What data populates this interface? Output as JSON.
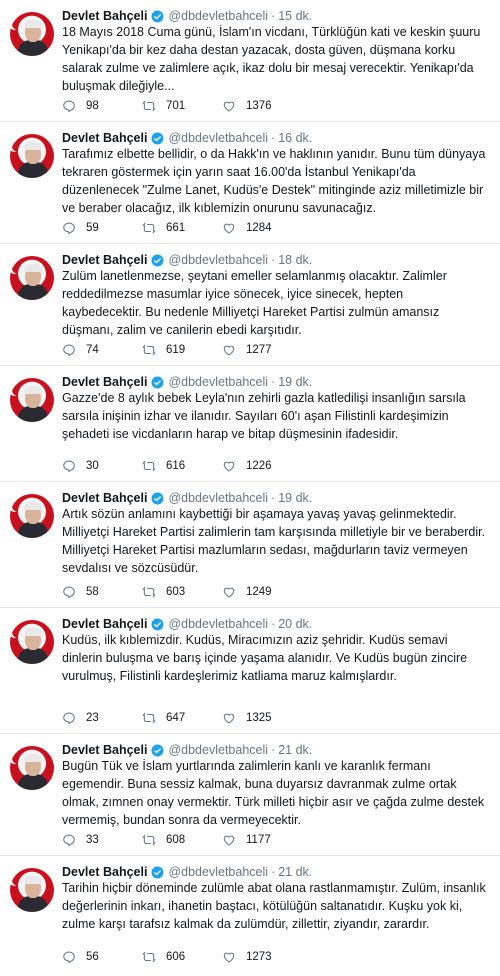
{
  "tweets": [
    {
      "name": "Devlet Bahçeli",
      "handle": "@dbdevletbahceli",
      "time": "15 dk.",
      "text": "18 Mayıs 2018 Cuma günü, İslam'ın vicdanı, Türklüğün kati ve keskin şuuru Yenikapı'da bir kez daha destan yazacak, dosta güven, düşmana korku salarak zulme ve zalimlere açık, ikaz dolu bir mesaj verecektir. Yenikapı'da buluşmak dileğiyle...",
      "replies": "98",
      "retweets": "701",
      "likes": "1376"
    },
    {
      "name": "Devlet Bahçeli",
      "handle": "@dbdevletbahceli",
      "time": "16 dk.",
      "text": "Tarafımız elbette bellidir, o da Hakk'ın ve haklının yanıdır. Bunu tüm dünyaya tekraren göstermek için yarın saat 16.00'da İstanbul Yenikapı'da düzenlenecek \"Zulme Lanet, Kudüs'e Destek\" mitinginde aziz milletimizle bir ve beraber olacağız, ilk kıblemizin onurunu savunacağız.",
      "replies": "59",
      "retweets": "661",
      "likes": "1284"
    },
    {
      "name": "Devlet Bahçeli",
      "handle": "@dbdevletbahceli",
      "time": "18 dk.",
      "text": "Zulüm lanetlenmezse, şeytani emeller selamlanmış olacaktır. Zalimler reddedilmezse masumlar iyice sönecek, iyice sinecek, hepten kaybedecektir. Bu nedenle Milliyetçi Hareket Partisi zulmün amansız düşmanı, zalim ve canilerin ebedi karşıtıdır.",
      "replies": "74",
      "retweets": "619",
      "likes": "1277"
    },
    {
      "name": "Devlet Bahçeli",
      "handle": "@dbdevletbahceli",
      "time": "19 dk.",
      "text": "Gazze'de 8 aylık bebek Leyla'nın zehirli gazla katledilişi insanlığın sarsıla sarsıla inişinin izhar ve ilanıdır. Sayıları 60'ı aşan Filistinli kardeşimizin şehadeti ise vicdanların harap ve bitap düşmesinin ifadesidir.",
      "replies": "30",
      "retweets": "616",
      "likes": "1226"
    },
    {
      "name": "Devlet Bahçeli",
      "handle": "@dbdevletbahceli",
      "time": "19 dk.",
      "text": "Artık sözün anlamını kaybettiği bir aşamaya yavaş yavaş gelinmektedir. Milliyetçi Hareket Partisi zalimlerin tam karşısında milletiyle bir ve beraberdir. Milliyetçi Hareket Partisi mazlumların sedası, mağdurların taviz vermeyen sevdalısı ve sözcüsüdür.",
      "replies": "58",
      "retweets": "603",
      "likes": "1249"
    },
    {
      "name": "Devlet Bahçeli",
      "handle": "@dbdevletbahceli",
      "time": "20 dk.",
      "text": "Kudüs, ilk kıblemizdir. Kudüs, Miracımızın aziz şehridir. Kudüs semavi dinlerin buluşma ve barış içinde yaşama alanıdır. Ve Kudüs bugün zincire vurulmuş, Filistinli kardeşlerimiz katliama maruz kalmışlardır.",
      "replies": "23",
      "retweets": "647",
      "likes": "1325"
    },
    {
      "name": "Devlet Bahçeli",
      "handle": "@dbdevletbahceli",
      "time": "21 dk.",
      "text": "Bugün Tük ve İslam yurtlarında zalimlerin kanlı ve karanlık fermanı egemendir. Buna sessiz kalmak, buna duyarsız davranmak zulme ortak olmak, zımnen onay vermektir. Türk milleti hiçbir asır ve çağda zulme destek vermemiş, bundan sonra da vermeyecektir.",
      "replies": "33",
      "retweets": "608",
      "likes": "1177"
    },
    {
      "name": "Devlet Bahçeli",
      "handle": "@dbdevletbahceli",
      "time": "21 dk.",
      "text": "Tarihin hiçbir döneminde zulümle abat olana rastlanmamıştır. Zulüm, insanlık değerlerinin inkarı, ihanetin baştacı, kötülüğün saltanatıdır. Kuşku yok ki, zulme karşı tarafsız kalmak da zulümdür, zillettir, ziyandır, zarardır.",
      "replies": "56",
      "retweets": "606",
      "likes": "1273"
    }
  ],
  "icons": {
    "verified": "verified-badge-icon",
    "reply": "reply-icon",
    "retweet": "retweet-icon",
    "like": "heart-icon"
  },
  "colors": {
    "accent": "#1da1f2",
    "text": "#14171a",
    "muted": "#657786",
    "divider": "#e6ecf0",
    "avatar_red": "#c9101f"
  }
}
